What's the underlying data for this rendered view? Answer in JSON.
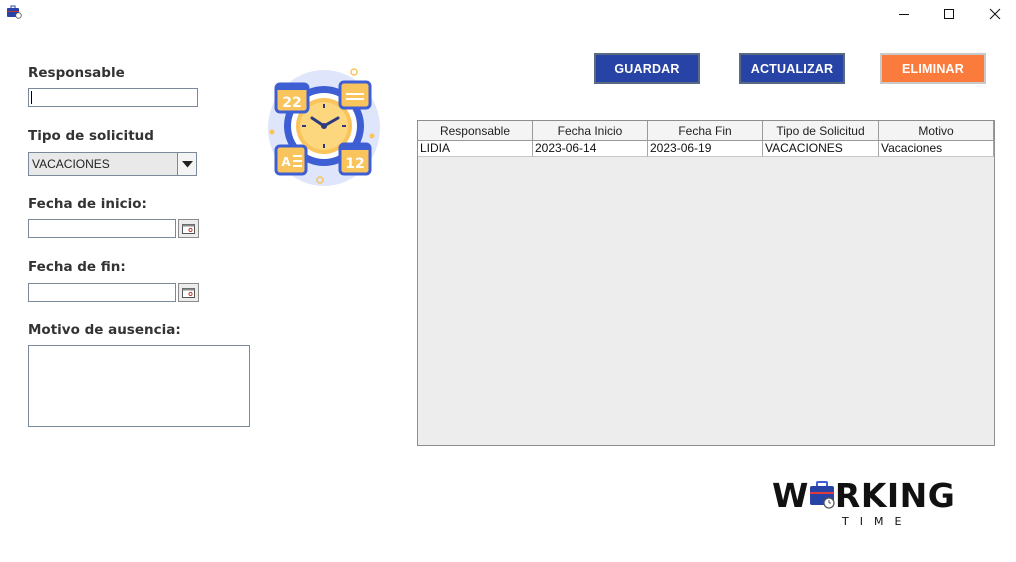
{
  "window": {
    "icon": "briefcase-clock-icon",
    "controls": [
      "minimize-icon",
      "maximize-icon",
      "close-icon"
    ]
  },
  "form": {
    "responsable_label": "Responsable",
    "responsable_value": "",
    "tipo_label": "Tipo de solicitud",
    "tipo_selected": "VACACIONES",
    "fecha_inicio_label": "Fecha de inicio:",
    "fecha_inicio_value": "",
    "fecha_fin_label": "Fecha de fin:",
    "fecha_fin_value": "",
    "motivo_label": "Motivo de ausencia:",
    "motivo_value": ""
  },
  "buttons": {
    "guardar": "GUARDAR",
    "actualizar": "ACTUALIZAR",
    "eliminar": "ELIMINAR"
  },
  "table": {
    "headers": [
      "Responsable",
      "Fecha Inicio",
      "Fecha Fin",
      "Tipo de Solicitud",
      "Motivo"
    ],
    "rows": [
      [
        "LIDIA",
        "2023-06-14",
        "2023-06-19",
        "VACACIONES",
        "Vacaciones"
      ]
    ]
  },
  "illustration": {
    "icon": "calendar-clock-icon",
    "numbers": [
      "22",
      "12"
    ]
  },
  "logo": {
    "word_before": "W",
    "word_after": "RKING",
    "subtitle": "TIME"
  },
  "colors": {
    "primary_button": "#2743a6",
    "danger_button": "#fb7b3d",
    "illustration_accent": "#f9c45c",
    "illustration_blue": "#3e5ed3"
  }
}
